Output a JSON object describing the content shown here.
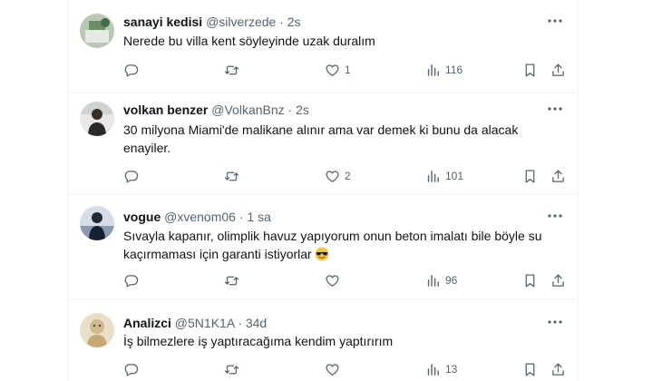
{
  "tweets": [
    {
      "name": "sanayi kedisi",
      "handle": "@silverzede",
      "separator": "·",
      "time": "2s",
      "text": "Nerede bu villa kent söyleyinde uzak duralım",
      "likes": "1",
      "views": "116"
    },
    {
      "name": "volkan benzer",
      "handle": "@VolkanBnz",
      "separator": "·",
      "time": "2s",
      "text": "30 milyona Miami'de malikane alınır ama var demek ki bunu da alacak enayiler.",
      "likes": "2",
      "views": "101"
    },
    {
      "name": "vogue",
      "handle": "@xvenom06",
      "separator": "·",
      "time": "1 sa",
      "text": "Sıvayla kapanır, olimplik havuz yapıyorum onun beton imalatı bile böyle su kaçırmaması için garanti istiyorlar",
      "likes": "",
      "views": "96"
    },
    {
      "name": "Analizci",
      "handle": "@5N1K1A",
      "separator": "·",
      "time": "34d",
      "text": "İş bilmezlere iş yaptıracağıma kendim yaptırırım",
      "likes": "",
      "views": "13"
    }
  ],
  "icons": {
    "reply": "reply-icon",
    "retweet": "retweet-icon",
    "like": "heart-icon",
    "views": "views-icon",
    "bookmark": "bookmark-icon",
    "share": "share-icon",
    "more": "more-icon",
    "emoji": "sunglasses-emoji"
  },
  "colors": {
    "text": "#0f1419",
    "muted": "#536471",
    "border": "#eff3f4"
  }
}
